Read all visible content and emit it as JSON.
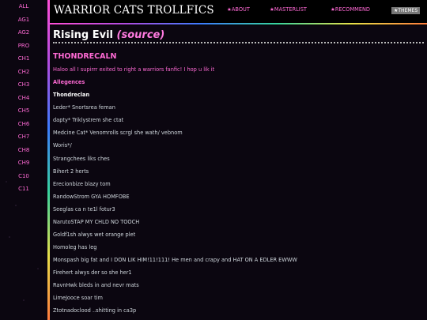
{
  "sidebar": {
    "items": [
      "ALL",
      "AG1",
      "AG2",
      "PRO",
      "CH1",
      "CH2",
      "CH3",
      "CH4",
      "CH5",
      "CH6",
      "CH7",
      "CH8",
      "CH9",
      "C10",
      "C11"
    ]
  },
  "header": {
    "title": "WARRIOR CATS TROLLFICS",
    "nav": {
      "about": "★ABOUT",
      "masterlist": "★MASTERLIST",
      "recommend": "★RECOMMEND",
      "themes": "★THEMES"
    }
  },
  "story": {
    "title": "Rising Evil",
    "source_label": "(source)",
    "chapter_title": "THONDRECALN",
    "intro": "Haloo all I supirrr exited to right a warriors fanfic! I hop u lik it",
    "section_label": "Allegences",
    "leader_label": "Thondreclan",
    "lines": [
      "Leder* Snortsrea feman",
      "dapty* Triklystrem she ctat",
      "Medcine Cat* Venomrolls scrgl she wath/ vebnom",
      "Woris*/",
      "Strangchees liks ches",
      "Bihert 2 herts",
      "Erecionbize blazy tom",
      "RandowStrom GYA HOMFOBE",
      "Seeglas ca n te1l fotur3",
      "NarutoSTAP MY CHLD NO TOOCH",
      "Goldf1sh alwys wet orange plet",
      "Homoleg has leg",
      "Monspash big fat and I DON LIK HIM!11!111! He men and crapy and HAT ON A EDLER EWWW",
      "Firehert alwys der so she her1",
      "RavnHwk bleds in and nevr mats",
      "LimeJooce soar tim",
      "Ztotnadoclood ..shitting in ca3p"
    ]
  }
}
